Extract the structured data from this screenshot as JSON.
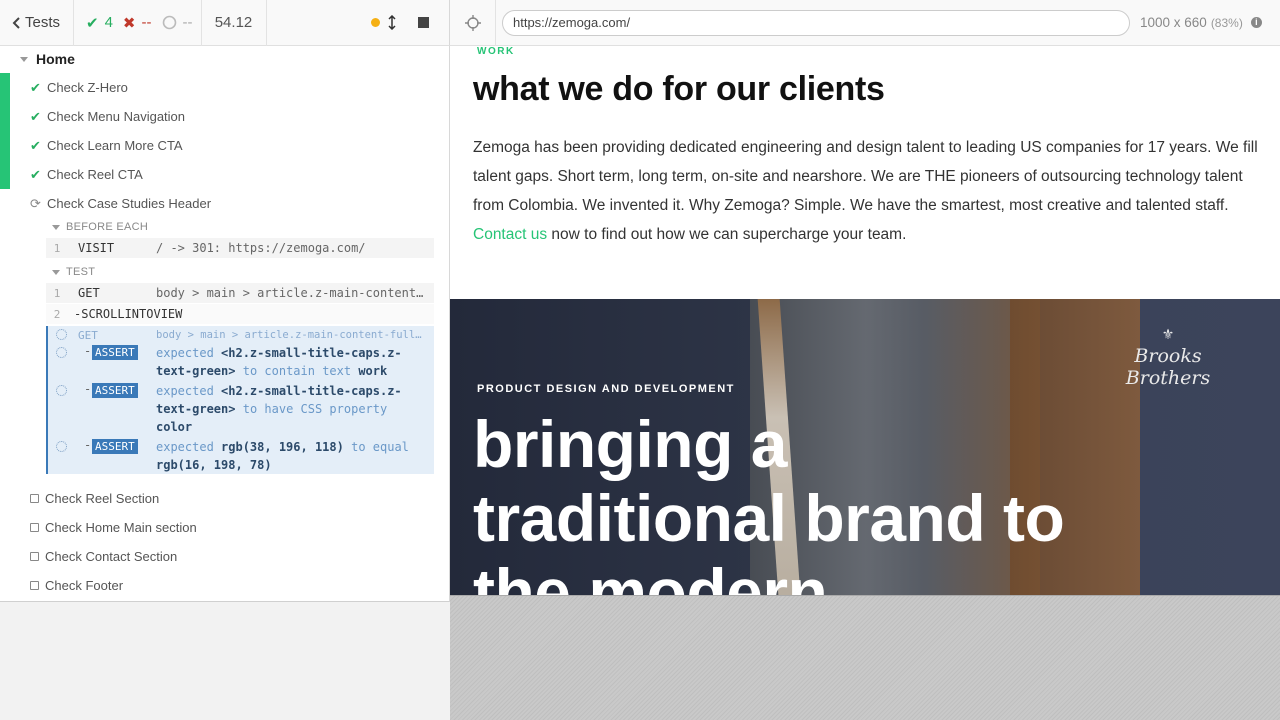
{
  "header": {
    "tests_label": "Tests",
    "passed": "4",
    "failed": "--",
    "pending": "--",
    "duration": "54.12"
  },
  "url_bar": {
    "url": "https://zemoga.com/",
    "viewport": "1000 x 660",
    "zoom": "(83%)"
  },
  "reporter": {
    "suite": "Home",
    "tests": [
      {
        "label": "Check Z-Hero",
        "state": "passed"
      },
      {
        "label": "Check Menu Navigation",
        "state": "passed"
      },
      {
        "label": "Check Learn More CTA",
        "state": "passed"
      },
      {
        "label": "Check Reel CTA",
        "state": "passed"
      },
      {
        "label": "Check Case Studies Header",
        "state": "running"
      },
      {
        "label": "Check Reel Section",
        "state": "pending"
      },
      {
        "label": "Check Home Main section",
        "state": "pending"
      },
      {
        "label": "Check Contact Section",
        "state": "pending"
      },
      {
        "label": "Check Footer",
        "state": "pending"
      }
    ],
    "before_each": {
      "title": "BEFORE EACH",
      "commands": [
        {
          "num": "1",
          "name": "VISIT",
          "msg": "/ -> 301: https://zemoga.com/"
        }
      ]
    },
    "test_body": {
      "title": "TEST",
      "commands": [
        {
          "num": "1",
          "name": "GET",
          "msg": "body > main > article.z-main-content…"
        },
        {
          "num": "2",
          "name": "-SCROLLINTOVIEW",
          "msg": ""
        }
      ]
    },
    "active": {
      "get_name": "GET",
      "get_msg": "body > main > article.z-main-content-full.z…",
      "asserts": [
        {
          "tag": "ASSERT",
          "w1": "expected",
          "b1": "<h2.z-small-title-caps.z-text-green>",
          "w2": "to contain text",
          "b2": "work"
        },
        {
          "tag": "ASSERT",
          "w1": "expected",
          "b1": "<h2.z-small-title-caps.z-text-green>",
          "w2": "to have CSS property",
          "b2": "color"
        },
        {
          "tag": "ASSERT",
          "w1": "expected",
          "b1": "rgb(38, 196, 118)",
          "w2": "to equal",
          "b2": "rgb(16, 198, 78)"
        }
      ]
    }
  },
  "aut": {
    "eyebrow": "WORK",
    "heading": "what we do for our clients",
    "paragraph_before_link": "Zemoga has been providing dedicated engineering and design talent to leading US companies for 17 years. We fill talent gaps. Short term, long term, on-site and nearshore. We are THE pioneers of outsourcing technology talent from Colombia. We invented it. Why Zemoga? Simple. We have the smartest, most creative and talented staff.",
    "link_text": "Contact us",
    "paragraph_after_link": "now to find out how we can supercharge your team.",
    "hero": {
      "eyebrow": "PRODUCT DESIGN AND DEVELOPMENT",
      "title": "bringing a traditional brand to the modern",
      "brand": "Brooks Brothers"
    }
  },
  "colors": {
    "accent_green": "#26c476",
    "assert_blue": "#3a79b8",
    "fail_red": "#c0392b"
  }
}
